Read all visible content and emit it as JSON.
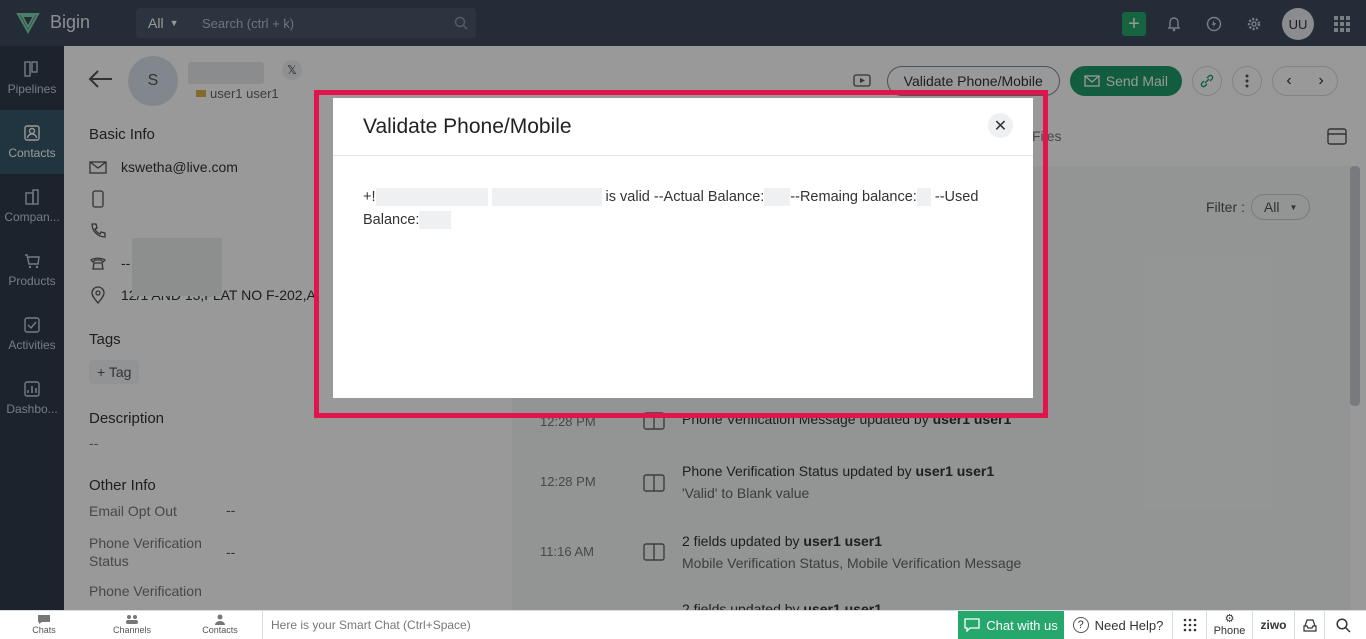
{
  "app": {
    "name": "Bigin"
  },
  "topbar": {
    "scope_label": "All",
    "search_placeholder": "Search (ctrl + k)",
    "avatar_initials": "UU"
  },
  "nav": {
    "items": [
      {
        "label": "Pipelines",
        "icon": "pipelines-icon"
      },
      {
        "label": "Contacts",
        "icon": "contacts-icon"
      },
      {
        "label": "Compan...",
        "icon": "companies-icon"
      },
      {
        "label": "Products",
        "icon": "products-icon"
      },
      {
        "label": "Activities",
        "icon": "activities-icon"
      },
      {
        "label": "Dashbo...",
        "icon": "dashboard-icon"
      }
    ]
  },
  "contact": {
    "avatar_initial": "S",
    "owner": "user1 user1",
    "validate_button": "Validate Phone/Mobile",
    "send_mail_button": "Send Mail",
    "basic_info_title": "Basic Info",
    "email": "kswetha@live.com",
    "phone_other": "--",
    "address": "12/1 AND 13,FLAT NO F-202,A",
    "tags_title": "Tags",
    "tag_button": "+ Tag",
    "description_title": "Description",
    "description_value": "--",
    "other_info_title": "Other Info",
    "other_info": [
      {
        "key": "Email Opt Out",
        "value": "--"
      },
      {
        "key": "Phone Verification Status",
        "value": "--"
      },
      {
        "key": "Phone Verification",
        "value": ""
      }
    ]
  },
  "timeline": {
    "tab_files": "Files",
    "filter_label": "Filter :",
    "filter_value": "All",
    "items": [
      {
        "time": "12:28 PM",
        "text": "Phone Verification Message updated by",
        "user": "user1 user1",
        "sub": ""
      },
      {
        "time": "12:28 PM",
        "text": "Phone Verification Status updated by",
        "user": "user1 user1",
        "sub": "'Valid' to Blank value"
      },
      {
        "time": "11:16 AM",
        "text": "2 fields updated by",
        "user": "user1 user1",
        "sub": "Mobile Verification Status, Mobile Verification Message"
      },
      {
        "time": "",
        "text": "2 fields updated by",
        "user": "user1 user1",
        "sub": ""
      }
    ]
  },
  "modal": {
    "title": "Validate Phone/Mobile",
    "msg_prefix": "+!",
    "msg_valid": "is valid --Actual Balance:",
    "msg_remaining": "--Remaing balance:",
    "msg_used": "--Used",
    "msg_used_balance": "Balance:"
  },
  "bottombar": {
    "tabs": [
      "Chats",
      "Channels",
      "Contacts"
    ],
    "smart_chat_placeholder": "Here is your Smart Chat (Ctrl+Space)",
    "chat_with_us": "Chat with us",
    "need_help": "Need Help?",
    "phone": "Phone",
    "brand": "ziwo"
  },
  "colors": {
    "topbar": "#3c4a5e",
    "sidebar": "#2f3b4c",
    "accent_green": "#1f9a6a",
    "highlight_border": "#e1154b"
  }
}
